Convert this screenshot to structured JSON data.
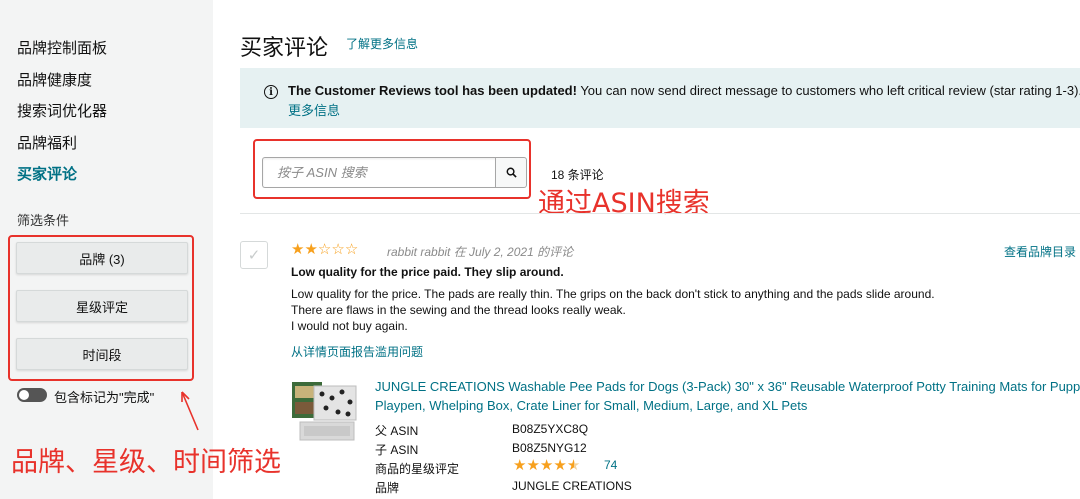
{
  "sidebar": {
    "nav": [
      "品牌控制面板",
      "品牌健康度",
      "搜索词优化器",
      "品牌福利",
      "买家评论"
    ],
    "filter_title": "筛选条件",
    "filters": [
      "品牌 (3)",
      "星级评定",
      "时间段"
    ],
    "toggle_label": "包含标记为\"完成\""
  },
  "header": {
    "title": "买家评论",
    "learn_more": "了解更多信息"
  },
  "banner": {
    "bold_text": "The Customer Reviews tool has been updated!",
    "text": " You can now send direct message to customers who left critical review (star rating 1-3).",
    "link": "更多信息"
  },
  "search": {
    "placeholder": "按子 ASIN 搜索",
    "review_count": "18 条评论"
  },
  "annotations": {
    "search_note": "通过ASIN搜索",
    "filter_note": "品牌、星级、时间筛选"
  },
  "review": {
    "rating": 2,
    "max_rating": 5,
    "meta": "rabbit rabbit 在 July 2, 2021 的评论",
    "view_brand": "查看品牌目录",
    "title": "Low quality for the price paid. They slip around.",
    "body": [
      "Low quality for the price. The pads are really thin. The grips on the back don't stick to anything and the pads slide around.",
      "There are flaws in the sewing and the thread looks really weak.",
      "I would not buy again."
    ],
    "report_link": "从详情页面报告滥用问题"
  },
  "product": {
    "title_line1": "JUNGLE CREATIONS Washable Pee Pads for Dogs (3-Pack) 30\" x 36\" Reusable Waterproof Potty Training Mats for Puppy",
    "title_line2": "Playpen, Whelping Box, Crate Liner for Small, Medium, Large, and XL Pets",
    "labels": {
      "parent_asin": "父 ASIN",
      "child_asin": "子 ASIN",
      "star_rating": "商品的星级评定",
      "brand": "品牌"
    },
    "parent_asin": "B08Z5YXC8Q",
    "child_asin": "B08Z5NYG12",
    "star_rating": 4.5,
    "rating_count": "74",
    "brand": "JUNGLE CREATIONS"
  },
  "colors": {
    "link": "#007185",
    "star": "#f7a01d",
    "annotation": "#e8322b",
    "banner_bg": "#e6f1f2"
  }
}
